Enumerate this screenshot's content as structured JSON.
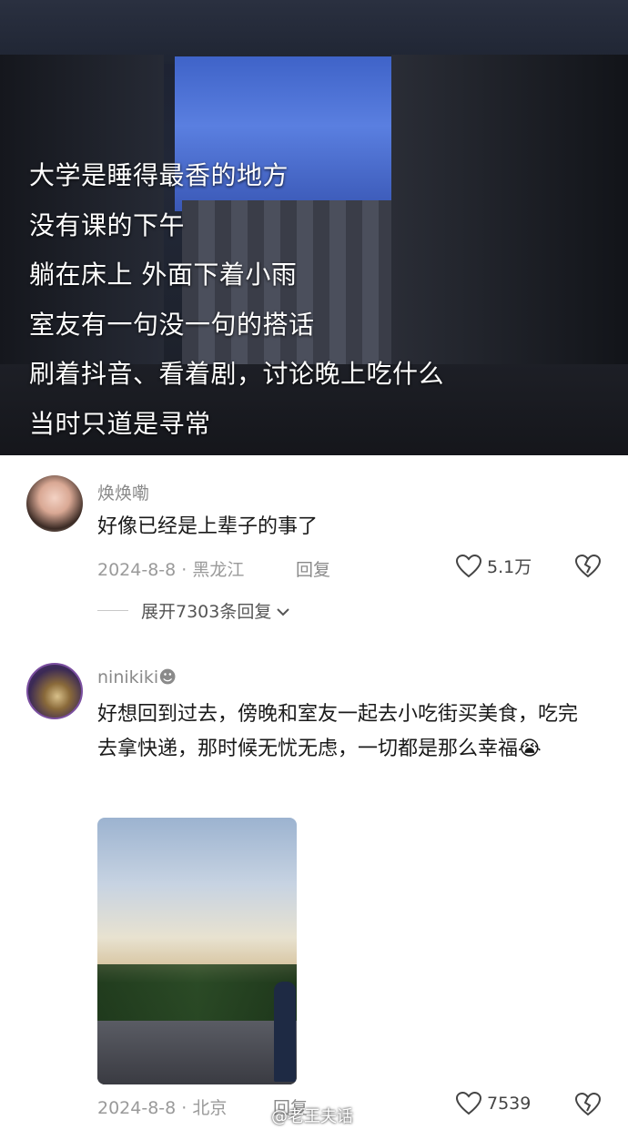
{
  "post": {
    "lines": [
      "大学是睡得最香的地方",
      "没有课的下午",
      "躺在床上 外面下着小雨",
      "室友有一句没一句的搭话",
      "刷着抖音、看着剧，讨论晚上吃什么",
      "当时只道是寻常"
    ]
  },
  "comments": [
    {
      "username": "焕焕嘞",
      "text": "好像已经是上辈子的事了",
      "date_location": "2024-8-8 · 黑龙江",
      "reply_label": "回复",
      "likes": "5.1万",
      "expand_label": "展开7303条回复"
    },
    {
      "username": "ninikiki☻",
      "text": "好想回到过去，傍晚和室友一起去小吃街买美食，吃完去拿快递，那时候无忧无虑，一切都是那么幸福😭",
      "date_location": "2024-8-8 · 北京",
      "reply_label": "回复",
      "likes": "7539"
    }
  ],
  "watermark": "@老王夫话",
  "colors": {
    "accent_purple": "#7b4fa0",
    "meta_gray": "#9a9a9a",
    "text_dark": "#1a1a1a"
  }
}
